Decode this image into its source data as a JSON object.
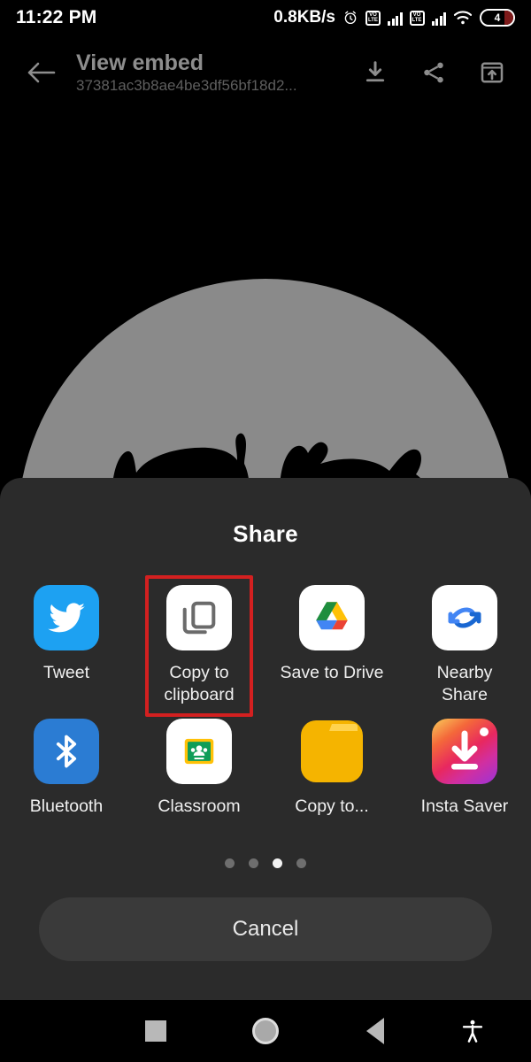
{
  "statusbar": {
    "time": "11:22 PM",
    "network_speed": "0.8KB/s",
    "alarm_icon": "alarm-clock-icon",
    "volte_label": "VO\nLTE",
    "volte_text_top": "VO",
    "volte_text_bottom": "LTE",
    "wifi_icon": "wifi-icon",
    "battery_level": "4"
  },
  "appbar": {
    "back_icon": "back-arrow-icon",
    "title": "View embed",
    "subtitle": "37381ac3b8ae4be3df56bf18d2...",
    "download_icon": "download-icon",
    "share_icon": "share-icon",
    "open_external_icon": "open-in-new-icon"
  },
  "share_sheet": {
    "title": "Share",
    "apps": [
      {
        "label": "Tweet",
        "icon": "twitter-bird-icon",
        "highlighted": false
      },
      {
        "label": "Copy to clipboard",
        "icon": "copy-to-clipboard-icon",
        "highlighted": true
      },
      {
        "label": "Save to Drive",
        "icon": "google-drive-icon",
        "highlighted": false
      },
      {
        "label": "Nearby Share",
        "icon": "nearby-share-icon",
        "highlighted": false
      },
      {
        "label": "Bluetooth",
        "icon": "bluetooth-icon",
        "highlighted": false
      },
      {
        "label": "Classroom",
        "icon": "google-classroom-icon",
        "highlighted": false
      },
      {
        "label": "Copy to...",
        "icon": "yellow-folder-icon",
        "highlighted": false
      },
      {
        "label": "Insta Saver",
        "icon": "insta-saver-download-icon",
        "highlighted": false
      }
    ],
    "page_dots": {
      "count": 4,
      "active_index": 2
    },
    "cancel_label": "Cancel"
  },
  "navbar": {
    "recents_icon": "square-recents-icon",
    "home_icon": "circle-home-icon",
    "back_icon": "triangle-back-icon",
    "accessibility_icon": "accessibility-icon"
  },
  "colors": {
    "sheet_bg": "#2b2b2b",
    "highlight": "#d32020",
    "twitter": "#1DA1F2",
    "bluetooth": "#2B7CD3",
    "folder": "#F5B400",
    "moon": "#8a8a8a"
  }
}
